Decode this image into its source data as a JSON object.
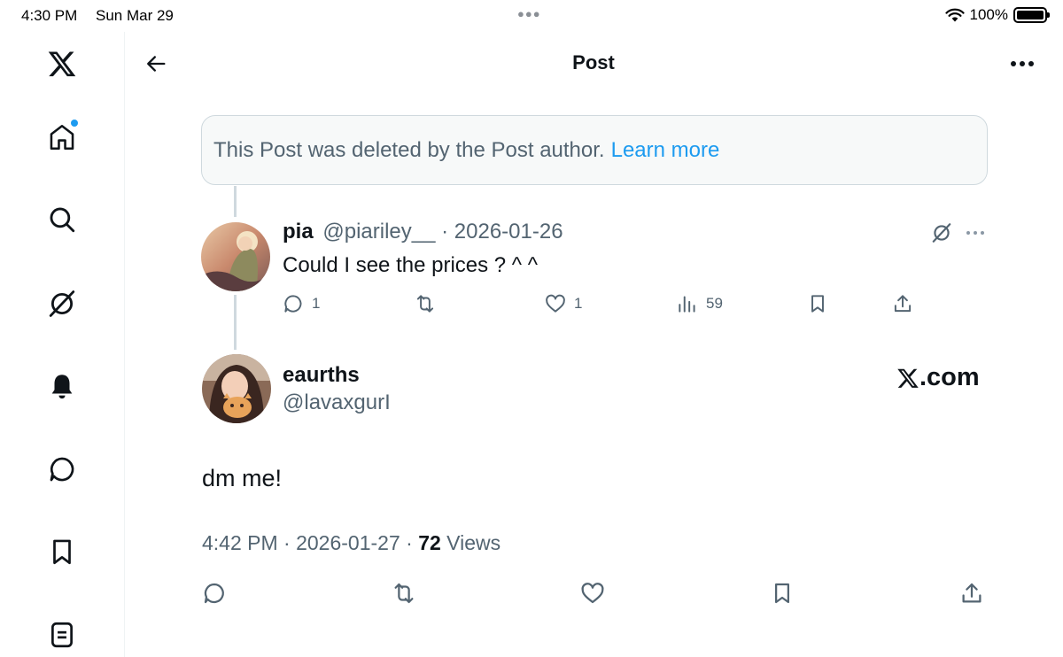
{
  "status_bar": {
    "time": "4:30 PM",
    "date": "Sun Mar 29",
    "battery": "100%"
  },
  "header": {
    "title": "Post"
  },
  "deleted_notice": {
    "text": "This Post was deleted by the Post author.",
    "link": "Learn more"
  },
  "reply": {
    "name": "pia",
    "handle": "@piariley__",
    "date": "· 2026-01-26",
    "text": "Could I see the prices ? ^ ^",
    "replies": "1",
    "likes": "1",
    "views": "59"
  },
  "post": {
    "author_name": "eaurths",
    "author_handle": "@lavaxgurI",
    "watermark": ".com",
    "text": "dm me!",
    "time": "4:42 PM",
    "date": "· 2026-01-27 ·",
    "views_count": "72",
    "views_label": "Views"
  },
  "colors": {
    "accent": "#1d9bf0",
    "text": "#0f1419",
    "secondary": "#536471",
    "border": "#cfd9de",
    "notice_bg": "#f7f9f9"
  },
  "icons": [
    "x-logo-icon",
    "home-icon",
    "search-icon",
    "grok-icon",
    "bell-icon",
    "messages-icon",
    "bookmark-icon",
    "lists-icon",
    "back-arrow-icon",
    "more-icon",
    "reply-icon",
    "repost-icon",
    "like-icon",
    "views-icon",
    "share-icon"
  ]
}
